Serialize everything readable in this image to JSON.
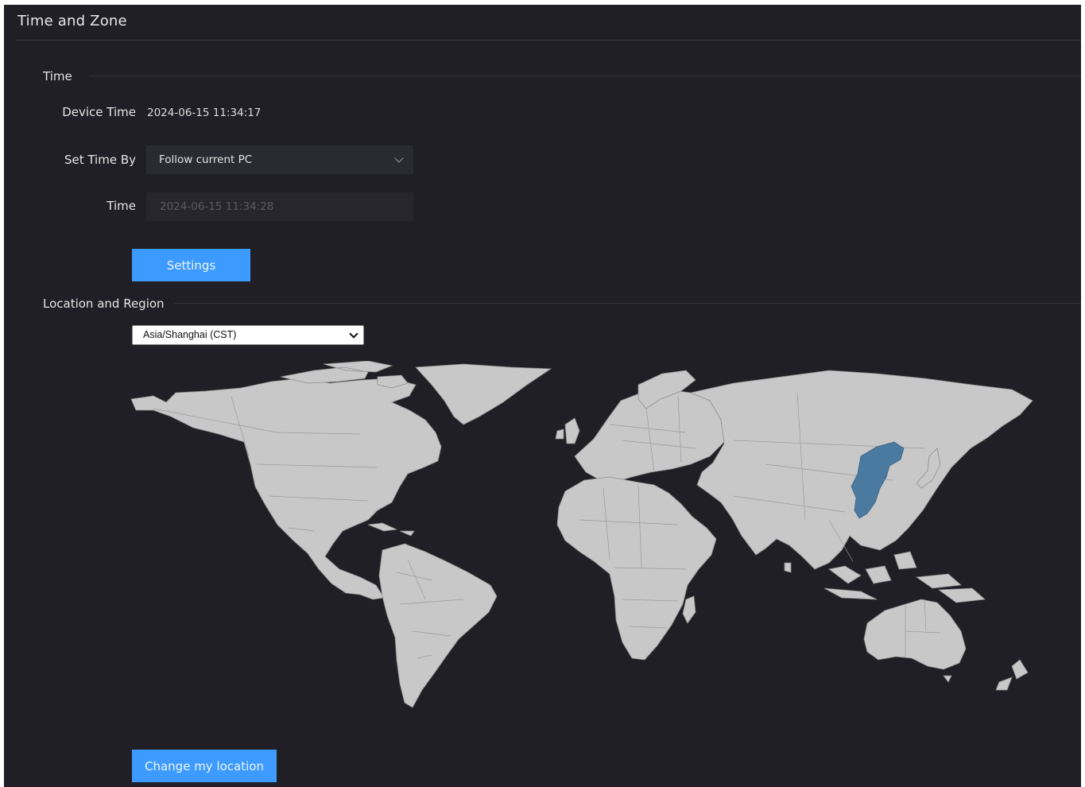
{
  "page": {
    "title": "Time and Zone"
  },
  "time_section": {
    "heading": "Time",
    "device_time_label": "Device Time",
    "device_time_value": "2024-06-15 11:34:17",
    "set_time_by_label": "Set Time By",
    "set_time_by_value": "Follow current PC",
    "time_label": "Time",
    "time_value": "2024-06-15 11:34:28",
    "settings_button": "Settings"
  },
  "location_section": {
    "heading": "Location and Region",
    "timezone_value": "Asia/Shanghai (CST)",
    "highlighted_region": "China",
    "highlight_color": "#4a7aa0",
    "land_color": "#c8c8c8",
    "change_location_button": "Change my location"
  },
  "colors": {
    "background": "#1f1f25",
    "accent": "#3d9bff"
  }
}
